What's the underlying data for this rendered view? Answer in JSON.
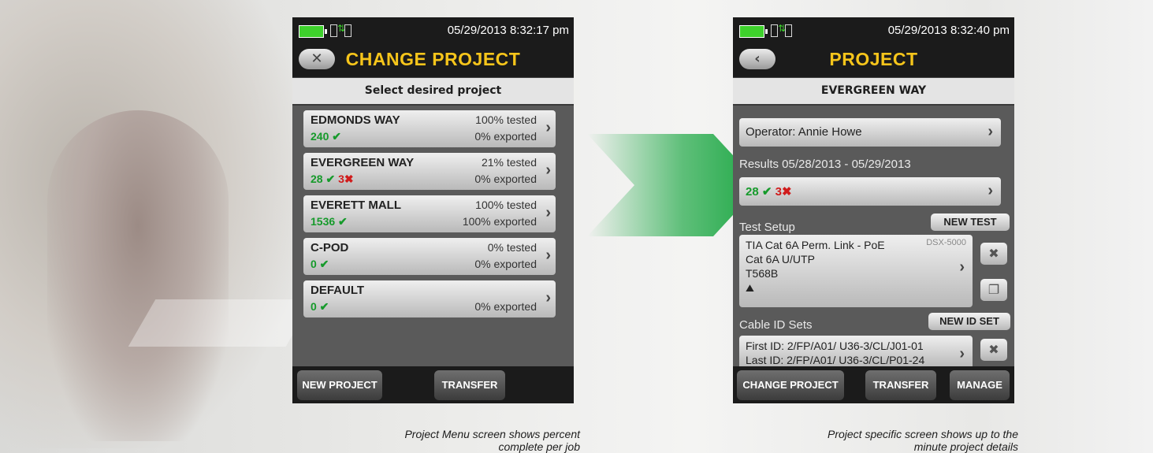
{
  "left_screen": {
    "datetime": "05/29/2013 8:32:17 pm",
    "back_icon": "x-icon",
    "title": "CHANGE PROJECT",
    "subheader": "Select desired project",
    "projects": [
      {
        "name": "EDMONDS WAY",
        "pass_count": "240",
        "fail_count": "",
        "tested": "100% tested",
        "exported": "0% exported"
      },
      {
        "name": "EVERGREEN WAY",
        "pass_count": "28",
        "fail_count": "3",
        "tested": "21% tested",
        "exported": "0% exported"
      },
      {
        "name": "EVERETT MALL",
        "pass_count": "1536",
        "fail_count": "",
        "tested": "100% tested",
        "exported": "100% exported"
      },
      {
        "name": "C-POD",
        "pass_count": "0",
        "fail_count": "",
        "tested": "0% tested",
        "exported": "0% exported"
      },
      {
        "name": "DEFAULT",
        "pass_count": "0",
        "fail_count": "",
        "tested": "",
        "exported": "0% exported"
      }
    ],
    "buttons": {
      "new_project": "NEW PROJECT",
      "transfer": "TRANSFER"
    },
    "caption_line1": "Project Menu screen shows percent",
    "caption_line2": "complete per job"
  },
  "right_screen": {
    "datetime": "05/29/2013 8:32:40 pm",
    "back_icon": "arrow-left-icon",
    "title": "PROJECT",
    "subheader": "EVERGREEN WAY",
    "operator": "Operator: Annie Howe",
    "results_label": "Results 05/28/2013 - 05/29/2013",
    "results_pass": "28",
    "results_fail": "3",
    "test_setup_label": "Test Setup",
    "new_test_button": "NEW TEST",
    "test_setup": {
      "line1": "TIA Cat 6A Perm. Link - PoE",
      "line2": "Cat 6A U/UTP",
      "line3": "T568B",
      "model": "DSX-5000"
    },
    "cable_id_label": "Cable ID Sets",
    "new_id_set_button": "NEW ID SET",
    "cable_ids": {
      "first": "First ID: 2/FP/A01/ U36-3/CL/J01-01",
      "last": "Last ID: 2/FP/A01/ U36-3/CL/P01-24"
    },
    "buttons": {
      "change_project": "CHANGE PROJECT",
      "transfer": "TRANSFER",
      "manage": "MANAGE"
    },
    "caption_line1": "Project specific screen shows up to the",
    "caption_line2": "minute project details"
  },
  "colors": {
    "accent_title": "#f6c51b",
    "pass": "#169a2b",
    "fail": "#d01c1c",
    "arrow": "#1ea845"
  }
}
